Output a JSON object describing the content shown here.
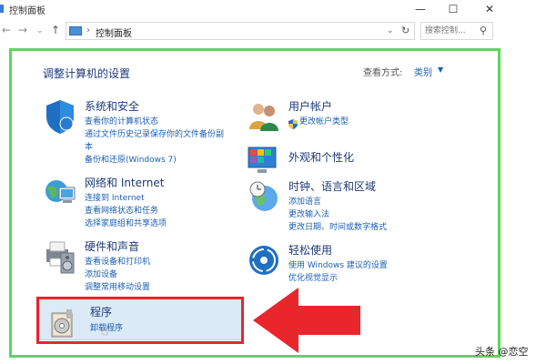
{
  "window": {
    "title": "控制面板",
    "min": "—",
    "max": "☐",
    "close": "✕"
  },
  "address": {
    "back": "←",
    "fwd": "→",
    "down": "⌄",
    "up": "↑",
    "sep": "›",
    "path": "控制面板",
    "dropdown": "⌄",
    "refresh": "↻",
    "search_placeholder": "搜索控制...",
    "search_icon": "⚲"
  },
  "main": {
    "heading": "调整计算机的设置",
    "view_by_label": "查看方式:",
    "view_by_value": "类别",
    "view_by_caret": "▼"
  },
  "categories": {
    "system": {
      "title": "系统和安全",
      "links": [
        "查看你的计算机状态",
        "通过文件历史记录保存你的文件备份副",
        "本",
        "备份和还原(Windows 7)"
      ]
    },
    "network": {
      "title": "网络和 Internet",
      "links": [
        "连接到 Internet",
        "查看网络状态和任务",
        "选择家庭组和共享选项"
      ]
    },
    "hardware": {
      "title": "硬件和声音",
      "links": [
        "查看设备和打印机",
        "添加设备",
        "调整常用移动设置"
      ]
    },
    "programs": {
      "title": "程序",
      "links": [
        "卸载程序"
      ]
    },
    "users": {
      "title": "用户帐户",
      "links": [
        "更改帐户类型"
      ]
    },
    "appearance": {
      "title": "外观和个性化",
      "links": []
    },
    "clock": {
      "title": "时钟、语言和区域",
      "links": [
        "添加语言",
        "更改输入法",
        "更改日期、时间或数字格式"
      ]
    },
    "ease": {
      "title": "轻松使用",
      "links": [
        "使用 Windows 建议的设置",
        "优化视觉显示"
      ]
    }
  },
  "watermark": "头条 @恋空",
  "colors": {
    "green_frame": "#5cd65c",
    "red_box": "#e8262c",
    "link": "#1a5fb4",
    "heading": "#1e3a78"
  }
}
